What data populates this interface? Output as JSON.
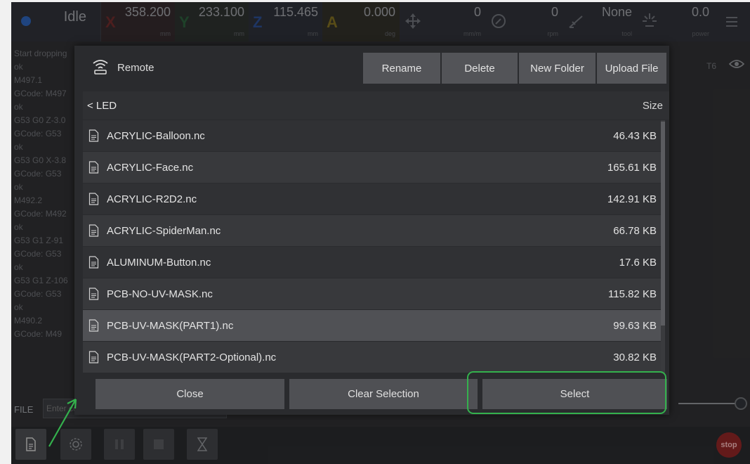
{
  "topbar": {
    "status": "Idle",
    "axes": [
      {
        "label": "X",
        "value": "358.200",
        "unit": "mm",
        "color": "#6a2a2a"
      },
      {
        "label": "Y",
        "value": "233.100",
        "unit": "mm",
        "color": "#2a5a3a"
      },
      {
        "label": "Z",
        "value": "115.465",
        "unit": "mm",
        "color": "#2a4a8a"
      },
      {
        "label": "A",
        "value": "0.000",
        "unit": "deg",
        "color": "#7a6a20"
      }
    ],
    "feed": {
      "value": "0",
      "unit": "mm/m"
    },
    "spindle": {
      "value": "0",
      "unit": "rpm"
    },
    "tool": {
      "value": "None",
      "unit": "tool"
    },
    "laser": {
      "value": "0.0",
      "unit": "power"
    }
  },
  "console_lines": [
    "Start dropping",
    "ok",
    "M497.1",
    "GCode: M497",
    "ok",
    "G53 G0 Z-3.0",
    "GCode: G53",
    "ok",
    "G53 G0 X-3.8",
    "GCode: G53",
    "ok",
    "M492.2",
    "GCode: M492",
    "ok",
    "G53 G1 Z-91",
    "GCode: G53",
    "ok",
    "G53 G1 Z-106",
    "GCode: G53",
    "ok",
    "M490.2",
    "GCode: M49"
  ],
  "right_panel": {
    "tool_tag": "T6"
  },
  "command_bar": {
    "label": "FILE",
    "placeholder": "Enter co"
  },
  "bottom_bar": {
    "stop_label": "stop"
  },
  "dialog": {
    "source_label": "Remote",
    "buttons": {
      "rename": "Rename",
      "delete": "Delete",
      "new_folder": "New Folder",
      "upload": "Upload File"
    },
    "folder": "< LED",
    "size_header": "Size",
    "files": [
      {
        "name": "ACRYLIC-Balloon.nc",
        "size": "46.43 KB",
        "selected": false
      },
      {
        "name": "ACRYLIC-Face.nc",
        "size": "165.61 KB",
        "selected": false
      },
      {
        "name": "ACRYLIC-R2D2.nc",
        "size": "142.91 KB",
        "selected": false
      },
      {
        "name": "ACRYLIC-SpiderMan.nc",
        "size": "66.78 KB",
        "selected": false
      },
      {
        "name": "ALUMINUM-Button.nc",
        "size": "17.6 KB",
        "selected": false
      },
      {
        "name": "PCB-NO-UV-MASK.nc",
        "size": "115.82 KB",
        "selected": false
      },
      {
        "name": "PCB-UV-MASK(PART1).nc",
        "size": "99.63 KB",
        "selected": true
      },
      {
        "name": "PCB-UV-MASK(PART2-Optional).nc",
        "size": "30.82 KB",
        "selected": false
      }
    ],
    "footer": {
      "close": "Close",
      "clear": "Clear Selection",
      "select": "Select"
    }
  },
  "colors": {
    "highlight": "#34b14d",
    "selected_row": "#505155",
    "even_row": "#38393c",
    "odd_row": "#303134"
  }
}
